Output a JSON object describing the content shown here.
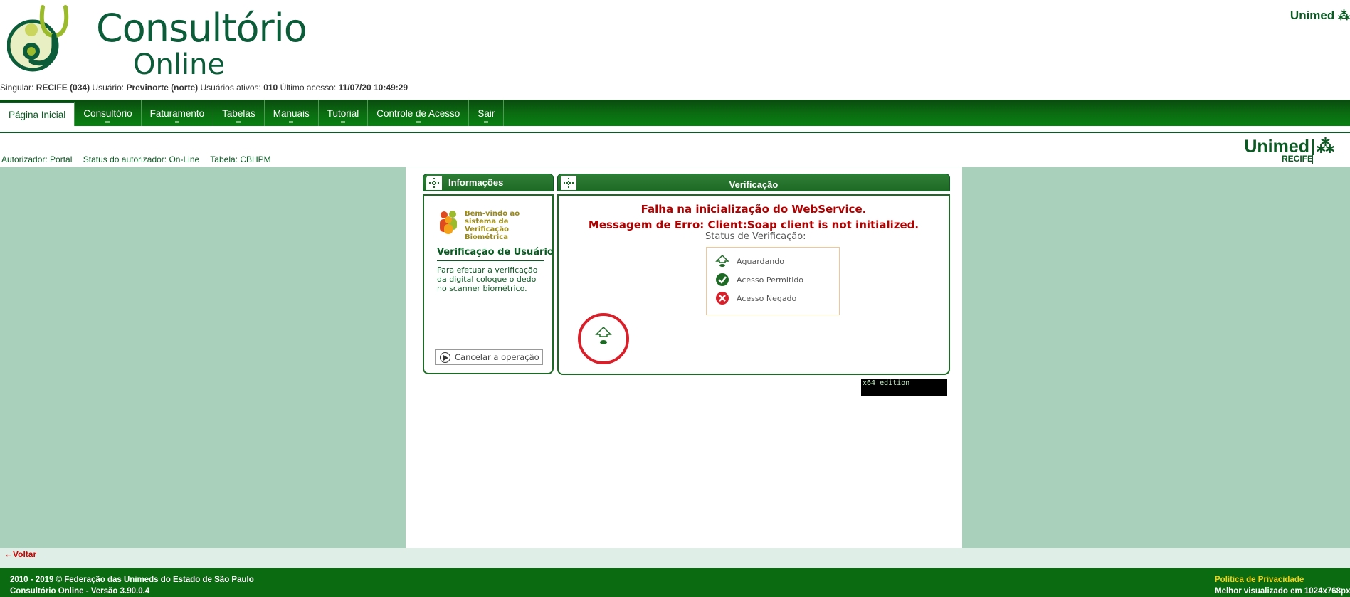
{
  "header": {
    "logo_line1": "Consultório",
    "logo_line2": "Online",
    "brand_top": "Unimed"
  },
  "userinfo": {
    "singular_label": "Singular:",
    "singular_value": "RECIFE (034)",
    "usuario_label": "Usuário:",
    "usuario_value": "Previnorte (norte)",
    "ativos_label": "Usuários ativos:",
    "ativos_value": "010",
    "acesso_label": "Último acesso:",
    "acesso_value": "11/07/20 10:49:29"
  },
  "nav": {
    "items": [
      {
        "label": "Página Inicial",
        "active": true
      },
      {
        "label": "Consultório"
      },
      {
        "label": "Faturamento"
      },
      {
        "label": "Tabelas"
      },
      {
        "label": "Manuais"
      },
      {
        "label": "Tutorial"
      },
      {
        "label": "Controle de Acesso"
      },
      {
        "label": "Sair"
      }
    ]
  },
  "statusbar": {
    "brand": "Unimed",
    "city": "RECIFE",
    "autorizador": "Autorizador: Portal",
    "status": "Status do autorizador: On-Line",
    "tabela": "Tabela: CBHPM"
  },
  "info_panel": {
    "title": "Informações",
    "welcome": "Bem-vindo ao sistema de Verificação Biométrica",
    "heading": "Verificação de Usuário",
    "text": "Para efetuar a verificação da digital coloque o dedo no scanner biométrico.",
    "cancel_label": "Cancelar a operação"
  },
  "verification_panel": {
    "title": "Verificação",
    "error1": "Falha na inicialização do WebService.",
    "error2": "Messagem de Erro: Client:Soap client is not initialized.",
    "status_title": "Status de Verificação:",
    "statuses": [
      {
        "label": "Aguardando",
        "icon": "fingerprint-waiting-icon"
      },
      {
        "label": "Acesso Permitido",
        "icon": "check-circle-icon",
        "color": "#1d6a24"
      },
      {
        "label": "Acesso Negado",
        "icon": "x-circle-icon",
        "color": "#d8202a"
      }
    ]
  },
  "edition": "x64 edition",
  "voltar": "Voltar",
  "footer": {
    "copyright": "2010 - 2019 © Federação das Unimeds do Estado de São Paulo",
    "version": "Consultório Online - Versão 3.90.0.4",
    "privacy": "Política de Privacidade",
    "best_view": "Melhor visualizado em 1024x768px"
  },
  "colors": {
    "primary_green": "#0b6b11",
    "error_red": "#b00000",
    "side_bg": "#a8d0bb"
  }
}
